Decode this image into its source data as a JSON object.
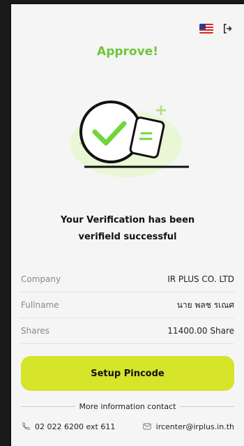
{
  "header": {
    "flag_icon": "us-flag-icon",
    "logout_icon": "logout-icon"
  },
  "title": "Approve!",
  "message": {
    "line1": "Your Verification has been",
    "line2": "verifield successful"
  },
  "details": [
    {
      "label": "Company",
      "value": "IR PLUS CO. LTD"
    },
    {
      "label": "Fullname",
      "value": "นาย พลช รเณศ"
    },
    {
      "label": "Shares",
      "value": "11400.00 Share"
    }
  ],
  "button": {
    "label": "Setup Pincode"
  },
  "contact": {
    "heading": "More information contact",
    "phone": "02 022 6200 ext 611",
    "email": "ircenter@irplus.in.th"
  },
  "colors": {
    "accent_green": "#6fc53a",
    "button": "#d6e42a"
  }
}
